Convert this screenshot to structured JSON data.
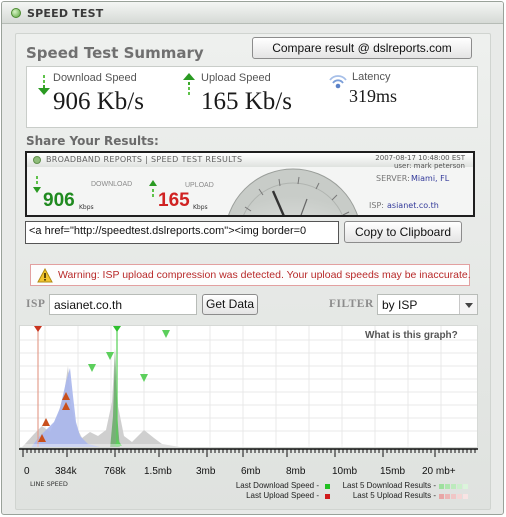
{
  "window": {
    "title": "SPEED TEST"
  },
  "summary": {
    "title": "Speed Test Summary",
    "compare_label": "Compare result @ dslreports.com",
    "download": {
      "label": "Download Speed",
      "value": "906 Kb/s"
    },
    "upload": {
      "label": "Upload Speed",
      "value": "165 Kb/s"
    },
    "latency": {
      "label": "Latency",
      "value": "319ms"
    }
  },
  "share": {
    "title": "Share Your Results:",
    "badge": {
      "header": "BROADBAND REPORTS | SPEED TEST RESULTS",
      "datetime": "2007-08-17 10:48:00 EST",
      "user": "user: mark peterson",
      "download_label": "DOWNLOAD",
      "download_value": "906",
      "upload_label": "UPLOAD",
      "upload_value": "165",
      "unit": "Kbps",
      "server_label": "SERVER:",
      "server_value": "Miami, FL",
      "isp_label": "ISP:",
      "isp_value": "asianet.co.th"
    },
    "embed_code": "<a href=\"http://speedtest.dslreports.com\"><img border=0",
    "copy_label": "Copy to Clipboard"
  },
  "warning": {
    "text": "Warning: ISP upload compression was detected. Your upload speeds may be inaccurate."
  },
  "controls": {
    "isp_label": "ISP",
    "isp_value": "asianet.co.th",
    "get_data_label": "Get Data",
    "filter_label": "FILTER",
    "filter_value": "by ISP"
  },
  "graph": {
    "help_label": "What is this graph?",
    "axis_ticks": [
      "0",
      "384k",
      "768k",
      "1.5mb",
      "3mb",
      "6mb",
      "8mb",
      "10mb",
      "15mb",
      "20 mb+"
    ],
    "line_speed_label": "LINE SPEED"
  },
  "legend": {
    "last_download": "Last Download Speed -",
    "last_upload": "Last Upload Speed -",
    "last5_download": "Last 5 Download Results -",
    "last5_upload": "Last 5 Upload Results -"
  },
  "colors": {
    "download": "#2aa82a",
    "upload": "#c9331d",
    "gauge_needle": "#333333"
  }
}
